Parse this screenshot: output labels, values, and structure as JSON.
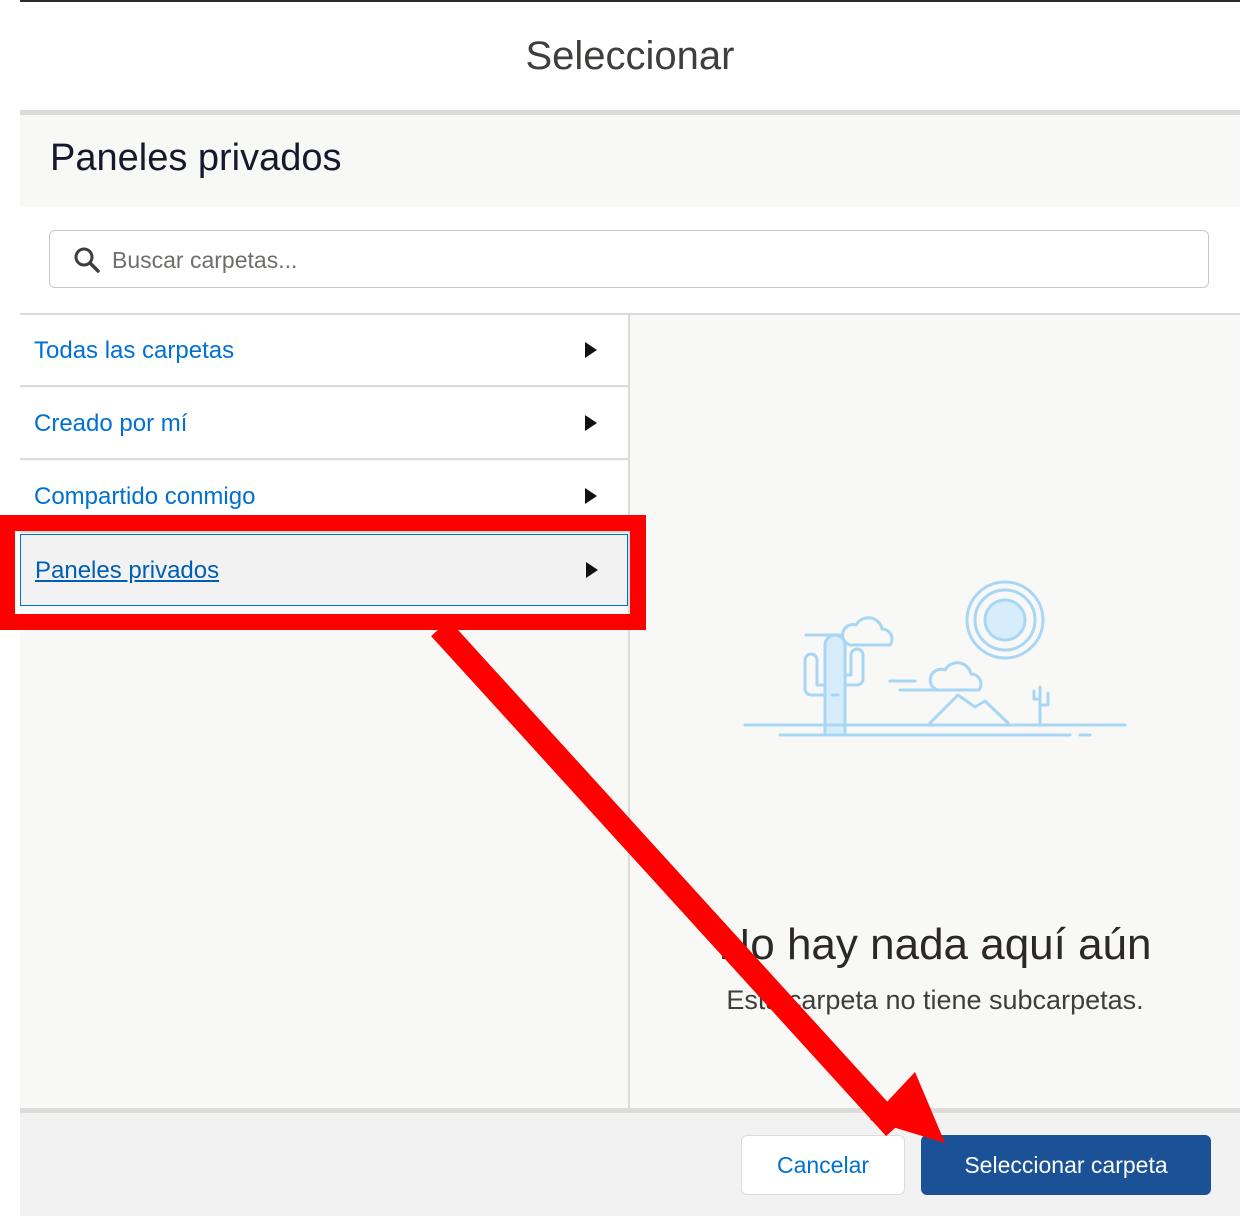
{
  "modal": {
    "title": "Seleccionar"
  },
  "section": {
    "title": "Paneles privados"
  },
  "search": {
    "placeholder": "Buscar carpetas..."
  },
  "folders": [
    {
      "label": "Todas las carpetas",
      "selected": false
    },
    {
      "label": "Creado por mí",
      "selected": false
    },
    {
      "label": "Compartido conmigo",
      "selected": false
    },
    {
      "label": "Paneles privados",
      "selected": true
    }
  ],
  "empty_state": {
    "title": "No hay nada aquí aún",
    "subtitle": "Esta carpeta no tiene subcarpetas."
  },
  "footer": {
    "cancel_label": "Cancelar",
    "select_label": "Seleccionar carpeta"
  },
  "colors": {
    "link": "#0070d2",
    "primary_button": "#1b5297",
    "annotation": "#ff0000",
    "illustration": "#a8d6f5"
  }
}
